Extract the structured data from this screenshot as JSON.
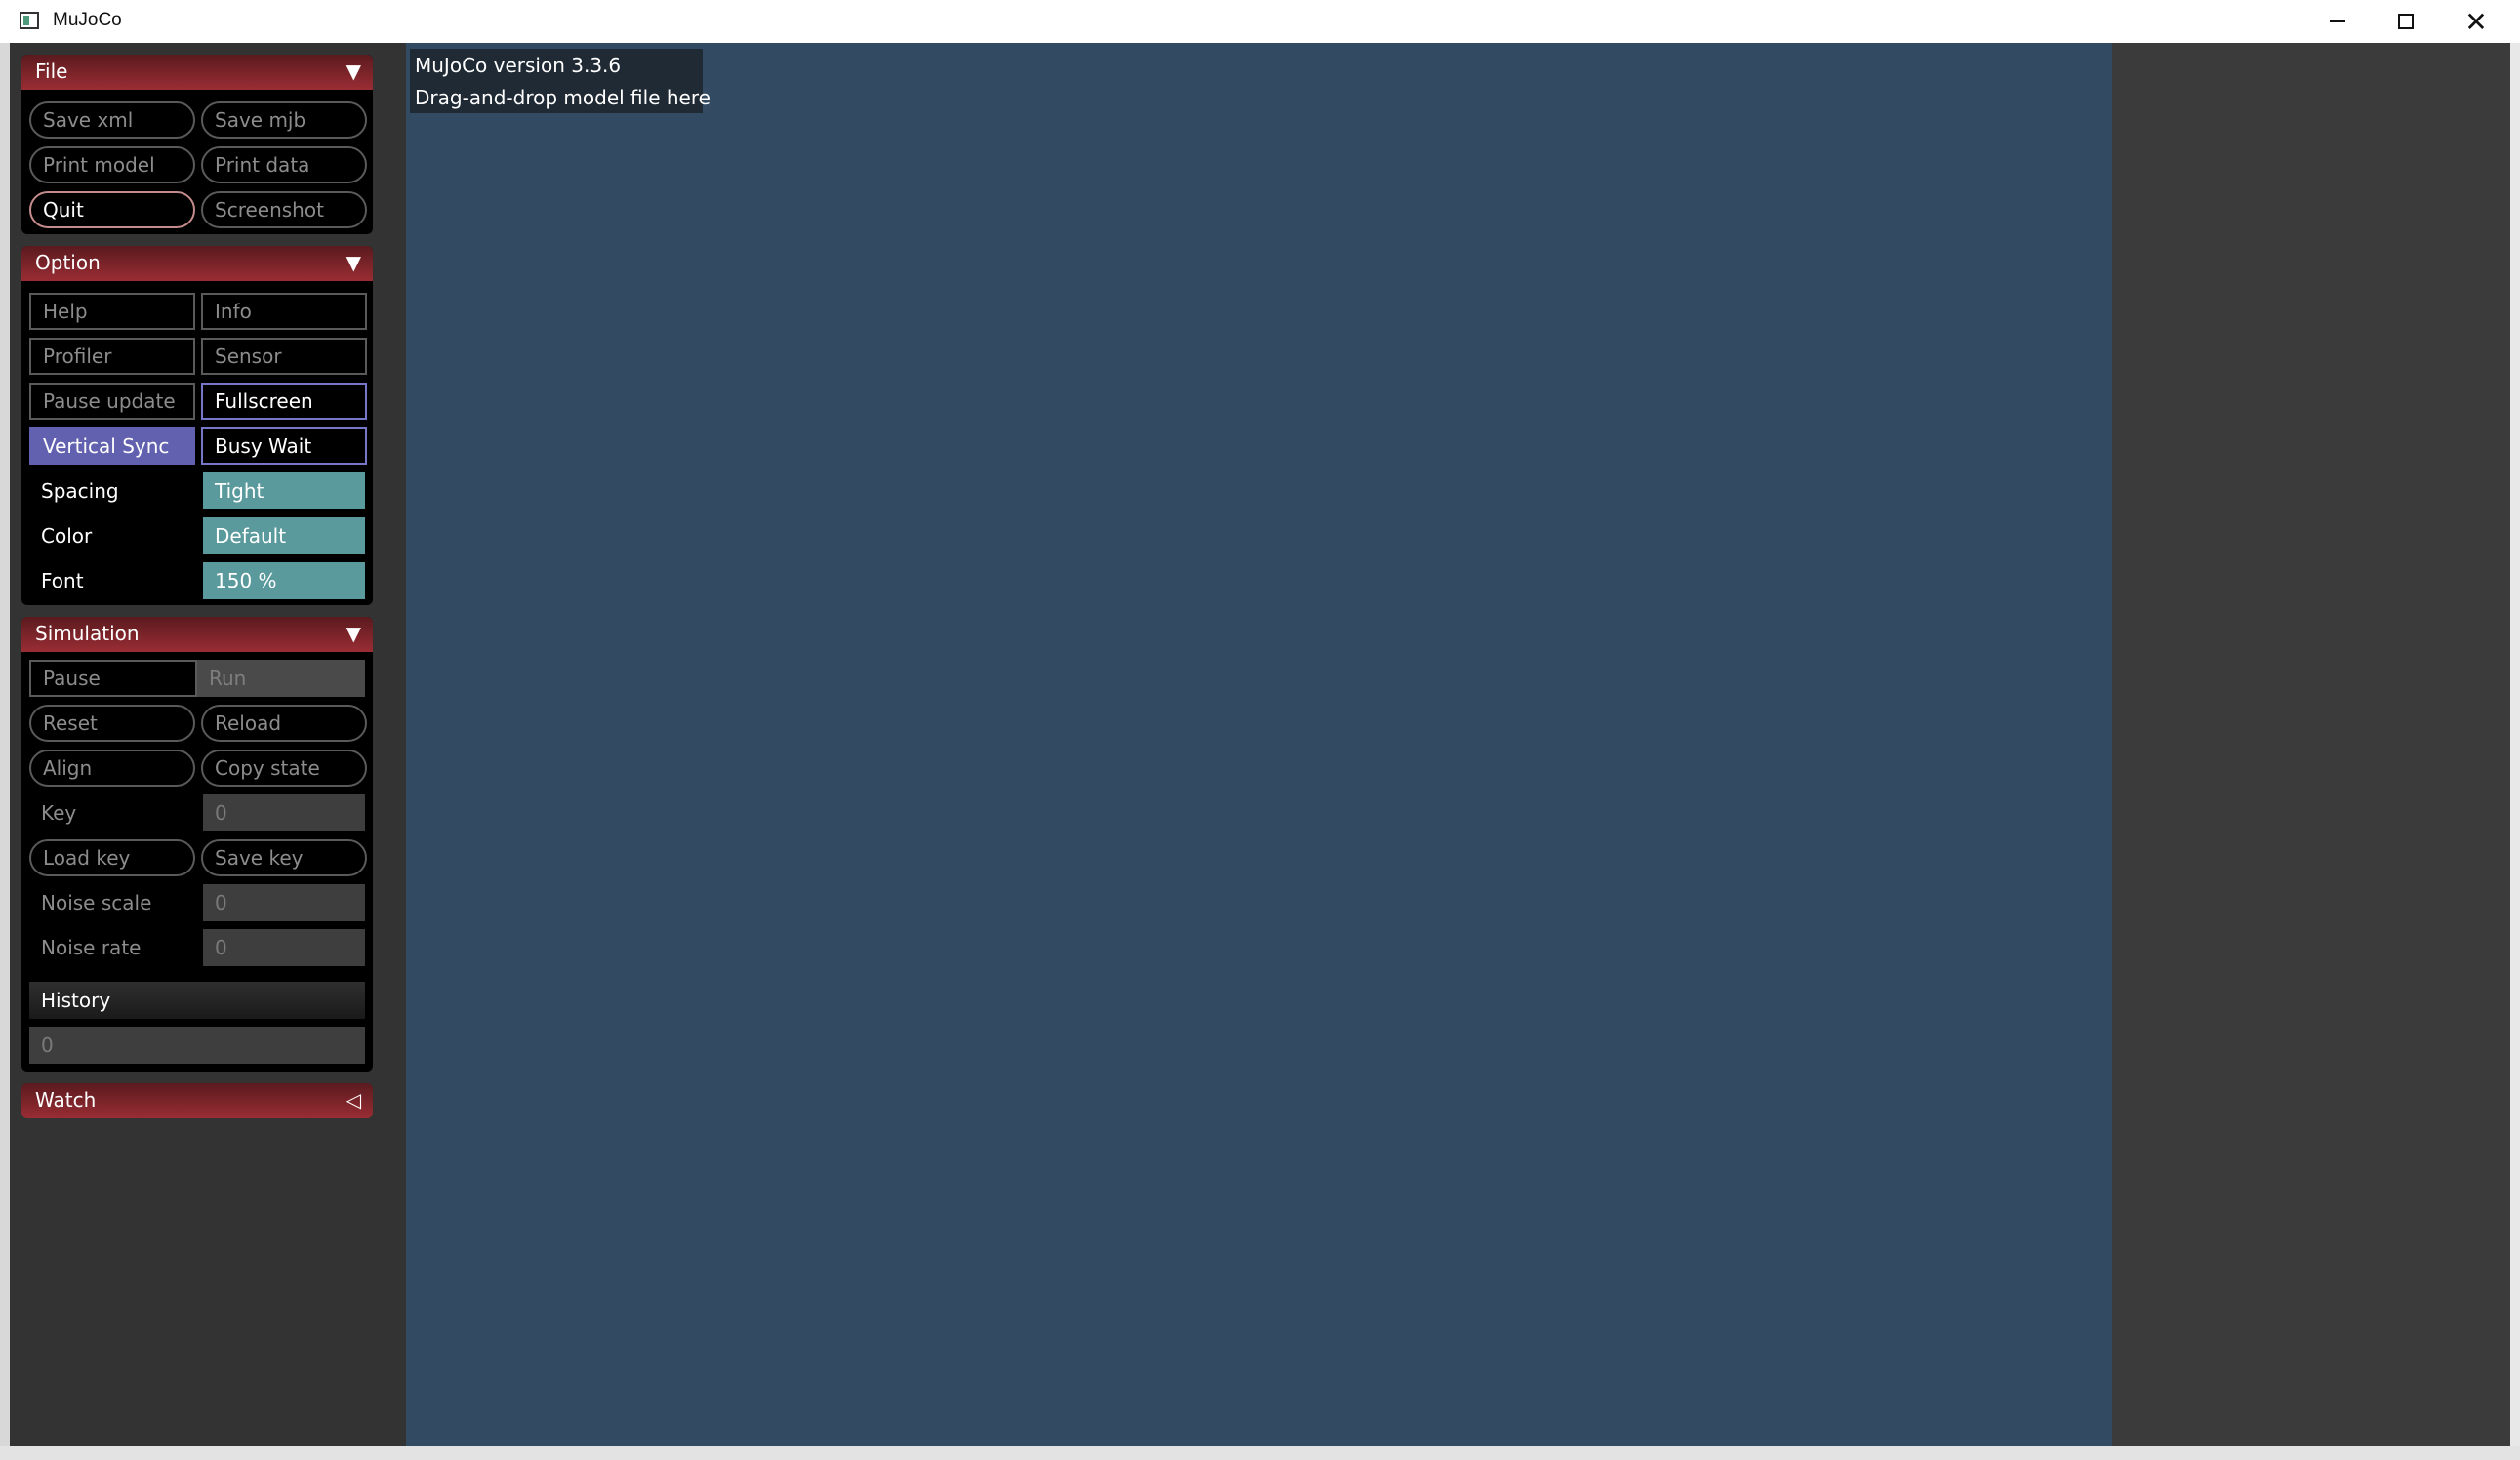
{
  "window": {
    "title": "MuJoCo"
  },
  "viewport": {
    "version_text": "MuJoCo version 3.3.6",
    "hint_text": "Drag-and-drop model file here"
  },
  "file": {
    "title": "File",
    "arrow": "▼",
    "save_xml": "Save xml",
    "save_mjb": "Save mjb",
    "print_model": "Print model",
    "print_data": "Print data",
    "quit": "Quit",
    "screenshot": "Screenshot"
  },
  "option": {
    "title": "Option",
    "arrow": "▼",
    "help": "Help",
    "info": "Info",
    "profiler": "Profiler",
    "sensor": "Sensor",
    "pause_update": "Pause update",
    "fullscreen": "Fullscreen",
    "vertical_sync": "Vertical Sync",
    "busy_wait": "Busy Wait",
    "spacing_label": "Spacing",
    "spacing_value": "Tight",
    "color_label": "Color",
    "color_value": "Default",
    "font_label": "Font",
    "font_value": "150 %"
  },
  "simulation": {
    "title": "Simulation",
    "arrow": "▼",
    "pause": "Pause",
    "run": "Run",
    "reset": "Reset",
    "reload": "Reload",
    "align": "Align",
    "copy_state": "Copy state",
    "key_label": "Key",
    "key_value": "0",
    "load_key": "Load key",
    "save_key": "Save key",
    "noise_scale_label": "Noise scale",
    "noise_scale_value": "0",
    "noise_rate_label": "Noise rate",
    "noise_rate_value": "0",
    "history_label": "History",
    "history_value": "0"
  },
  "watch": {
    "title": "Watch",
    "arrow": "◁"
  },
  "colors": {
    "header_red": "#9a2d34",
    "viewport_blue": "#324a62",
    "select_teal": "#5a9a9c",
    "check_purple": "#6161b0"
  }
}
